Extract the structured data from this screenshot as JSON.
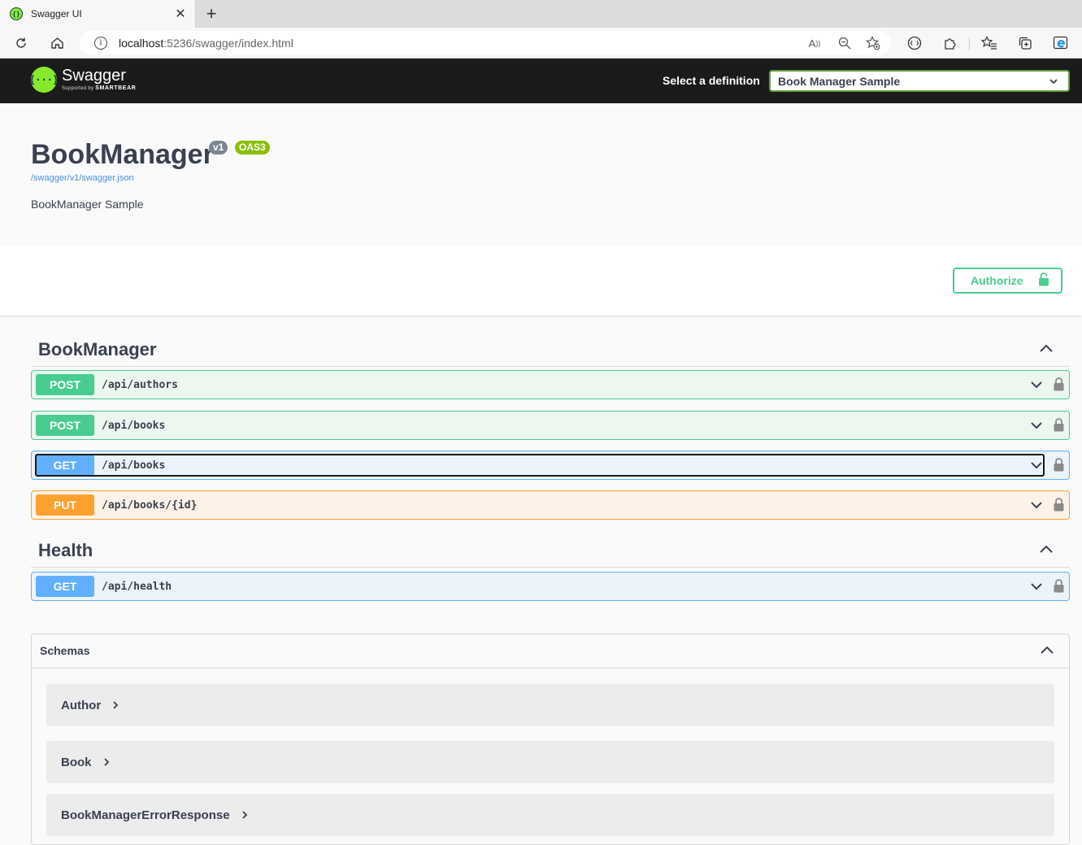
{
  "browser": {
    "tab_title": "Swagger UI",
    "url_host": "localhost",
    "url_rest": ":5236/swagger/index.html"
  },
  "topbar": {
    "logo_name": "Swagger",
    "logo_supported": "Supported by",
    "logo_brand": "SMARTBEAR",
    "definition_label": "Select a definition",
    "definition_value": "Book Manager Sample"
  },
  "info": {
    "title": "BookManager",
    "version": "v1",
    "oas": "OAS3",
    "json_url": "/swagger/v1/swagger.json",
    "description": "BookManager Sample"
  },
  "authorize": {
    "label": "Authorize"
  },
  "tags": [
    {
      "name": "BookManager",
      "operations": [
        {
          "method": "POST",
          "path": "/api/authors"
        },
        {
          "method": "POST",
          "path": "/api/books"
        },
        {
          "method": "GET",
          "path": "/api/books"
        },
        {
          "method": "PUT",
          "path": "/api/books/{id}"
        }
      ]
    },
    {
      "name": "Health",
      "operations": [
        {
          "method": "GET",
          "path": "/api/health"
        }
      ]
    }
  ],
  "schemas": {
    "title": "Schemas",
    "models": [
      "Author",
      "Book",
      "BookManagerErrorResponse"
    ]
  },
  "colors": {
    "post": "#49cc90",
    "get": "#61affe",
    "put": "#fca130",
    "swagger_green": "#85ea2d",
    "topbar": "#1b1b1b"
  }
}
